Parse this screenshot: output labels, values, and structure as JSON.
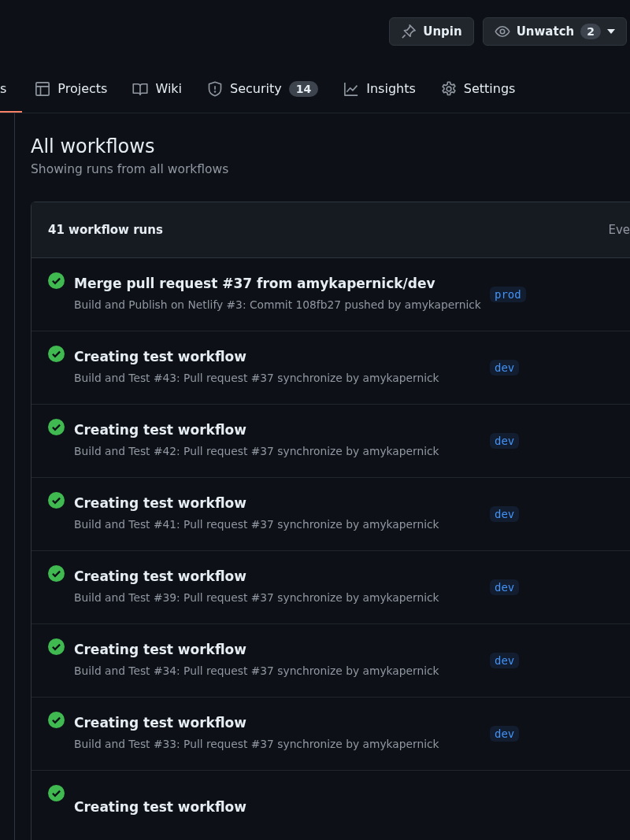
{
  "actions": [
    {
      "kind": "pin",
      "label": "Unpin"
    },
    {
      "kind": "watch",
      "label": "Unwatch",
      "count": "2"
    }
  ],
  "tabs": [
    {
      "kind": "actions",
      "label": "s",
      "selected": true
    },
    {
      "kind": "projects",
      "label": "Projects",
      "selected": false
    },
    {
      "kind": "wiki",
      "label": "Wiki",
      "selected": false
    },
    {
      "kind": "security",
      "label": "Security",
      "count": "14",
      "selected": false
    },
    {
      "kind": "insights",
      "label": "Insights",
      "selected": false
    },
    {
      "kind": "settings",
      "label": "Settings",
      "selected": false
    }
  ],
  "page": {
    "title": "All workflows",
    "subtitle": "Showing runs from all workflows"
  },
  "runs_table": {
    "count_label": "41 workflow runs",
    "filter_label": "Eve",
    "rows": [
      {
        "title": "Merge pull request #37 from amykapernick/dev",
        "detail": "Build and Publish on Netlify #3: Commit 108fb27 pushed by amykapernick",
        "branch": "prod",
        "kind": "success"
      },
      {
        "title": "Creating test workflow",
        "detail": "Build and Test #43: Pull request #37 synchronize by amykapernick",
        "branch": "dev",
        "kind": "success"
      },
      {
        "title": "Creating test workflow",
        "detail": "Build and Test #42: Pull request #37 synchronize by amykapernick",
        "branch": "dev",
        "kind": "success"
      },
      {
        "title": "Creating test workflow",
        "detail": "Build and Test #41: Pull request #37 synchronize by amykapernick",
        "branch": "dev",
        "kind": "success"
      },
      {
        "title": "Creating test workflow",
        "detail": "Build and Test #39: Pull request #37 synchronize by amykapernick",
        "branch": "dev",
        "kind": "success"
      },
      {
        "title": "Creating test workflow",
        "detail": "Build and Test #34: Pull request #37 synchronize by amykapernick",
        "branch": "dev",
        "kind": "success"
      },
      {
        "title": "Creating test workflow",
        "detail": "Build and Test #33: Pull request #37 synchronize by amykapernick",
        "branch": "dev",
        "kind": "success"
      },
      {
        "title": "Creating test workflow",
        "kind": "success"
      }
    ]
  }
}
